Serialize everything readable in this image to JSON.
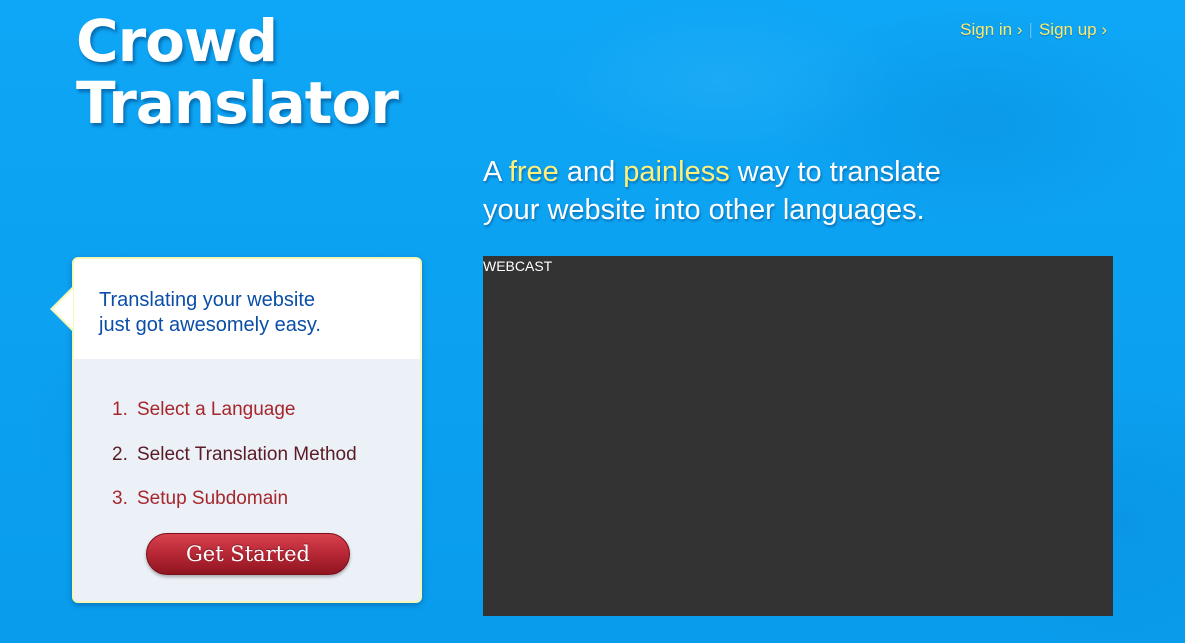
{
  "logo": {
    "line1": "Crowd",
    "line2": "Translator"
  },
  "auth": {
    "sign_in": "Sign in ›",
    "separator": "|",
    "sign_up": "Sign up ›"
  },
  "tagline": {
    "a": "A ",
    "free": "free",
    "and": " and ",
    "painless": "painless",
    "rest1": " way to translate",
    "line2": "your website into other languages."
  },
  "panel": {
    "head_line1": "Translating your website",
    "head_line2": "just got awesomely easy.",
    "steps": [
      {
        "num": "1.",
        "label": "Select a Language"
      },
      {
        "num": "2.",
        "label": "Select Translation Method"
      },
      {
        "num": "3.",
        "label": "Setup Subdomain"
      }
    ],
    "cta_label": "Get Started"
  },
  "webcast": {
    "label": "WEBCAST"
  },
  "colors": {
    "background": "#0aa0f0",
    "accent_yellow": "#fff07a",
    "link_yellow": "#ffe96a",
    "step_red": "#a6262c",
    "heading_blue": "#0b4ea8",
    "button_red": "#b72735",
    "webcast_bg": "#333333"
  }
}
